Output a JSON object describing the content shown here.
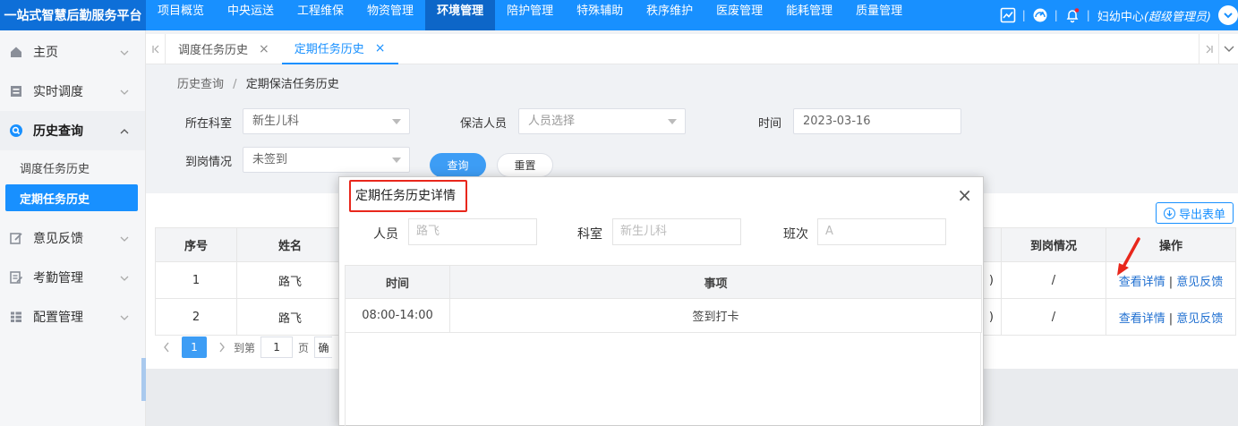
{
  "app": {
    "title": "一站式智慧后勤服务平台"
  },
  "topnav": [
    {
      "label": "项目概览",
      "active": false
    },
    {
      "label": "中央运送",
      "active": false
    },
    {
      "label": "工程维保",
      "active": false
    },
    {
      "label": "物资管理",
      "active": false
    },
    {
      "label": "环境管理",
      "active": true
    },
    {
      "label": "陪护管理",
      "active": false
    },
    {
      "label": "特殊辅助",
      "active": false
    },
    {
      "label": "秩序维护",
      "active": false
    },
    {
      "label": "医废管理",
      "active": false
    },
    {
      "label": "能耗管理",
      "active": false
    },
    {
      "label": "质量管理",
      "active": false
    }
  ],
  "user": {
    "org": "妇幼中心",
    "role": "(超级管理员)",
    "separator": "|"
  },
  "sidebar": {
    "items": [
      {
        "label": "主页",
        "icon": "home-icon"
      },
      {
        "label": "实时调度",
        "icon": "dispatch-icon"
      },
      {
        "label": "历史查询",
        "icon": "search-icon"
      },
      {
        "label": "意见反馈",
        "icon": "feedback-icon"
      },
      {
        "label": "考勤管理",
        "icon": "attendance-icon"
      },
      {
        "label": "配置管理",
        "icon": "config-icon"
      }
    ],
    "subitems": [
      {
        "label": "调度任务历史"
      },
      {
        "label": "定期任务历史"
      }
    ]
  },
  "tabs": [
    {
      "label": "调度任务历史",
      "close": "×"
    },
    {
      "label": "定期任务历史",
      "close": "×"
    }
  ],
  "breadcrumb": {
    "parent": "历史查询",
    "sep": "/",
    "current": "定期保洁任务历史"
  },
  "filter": {
    "dept_label": "所在科室",
    "dept_value": "新生儿科",
    "cleaner_label": "保洁人员",
    "cleaner_placeholder": "人员选择",
    "time_label": "时间",
    "time_value": "2023-03-16",
    "arrival_label": "到岗情况",
    "arrival_value": "未签到",
    "query_button": "查询",
    "reset_button": "重置"
  },
  "table": {
    "export_label": "导出表单",
    "headers": {
      "seq": "序号",
      "name": "姓名",
      "arrival": "到岗情况",
      "ops": "操作"
    },
    "rows": [
      {
        "seq": "1",
        "name": "路飞",
        "hidden_tail": ")",
        "arrival": "/",
        "detail": "查看详情",
        "sep": "|",
        "feedback": "意见反馈"
      },
      {
        "seq": "2",
        "name": "路飞",
        "hidden_tail": ")",
        "arrival": "/",
        "detail": "查看详情",
        "sep": "|",
        "feedback": "意见反馈"
      }
    ]
  },
  "pagination": {
    "current": "1",
    "goto_prefix": "到第",
    "goto_value": "1",
    "goto_suffix": "页",
    "confirm_partial": "确"
  },
  "modal": {
    "title": "定期任务历史详情",
    "close": "×",
    "person_label": "人员",
    "person_value": "路飞",
    "dept_label": "科室",
    "dept_value": "新生儿科",
    "shift_label": "班次",
    "shift_value": "A",
    "headers": {
      "time": "时间",
      "item": "事项"
    },
    "rows": [
      {
        "time": "08:00-14:00",
        "item": "签到打卡"
      }
    ]
  },
  "colors": {
    "primary": "#1890ff",
    "annotation": "#e8271c"
  }
}
